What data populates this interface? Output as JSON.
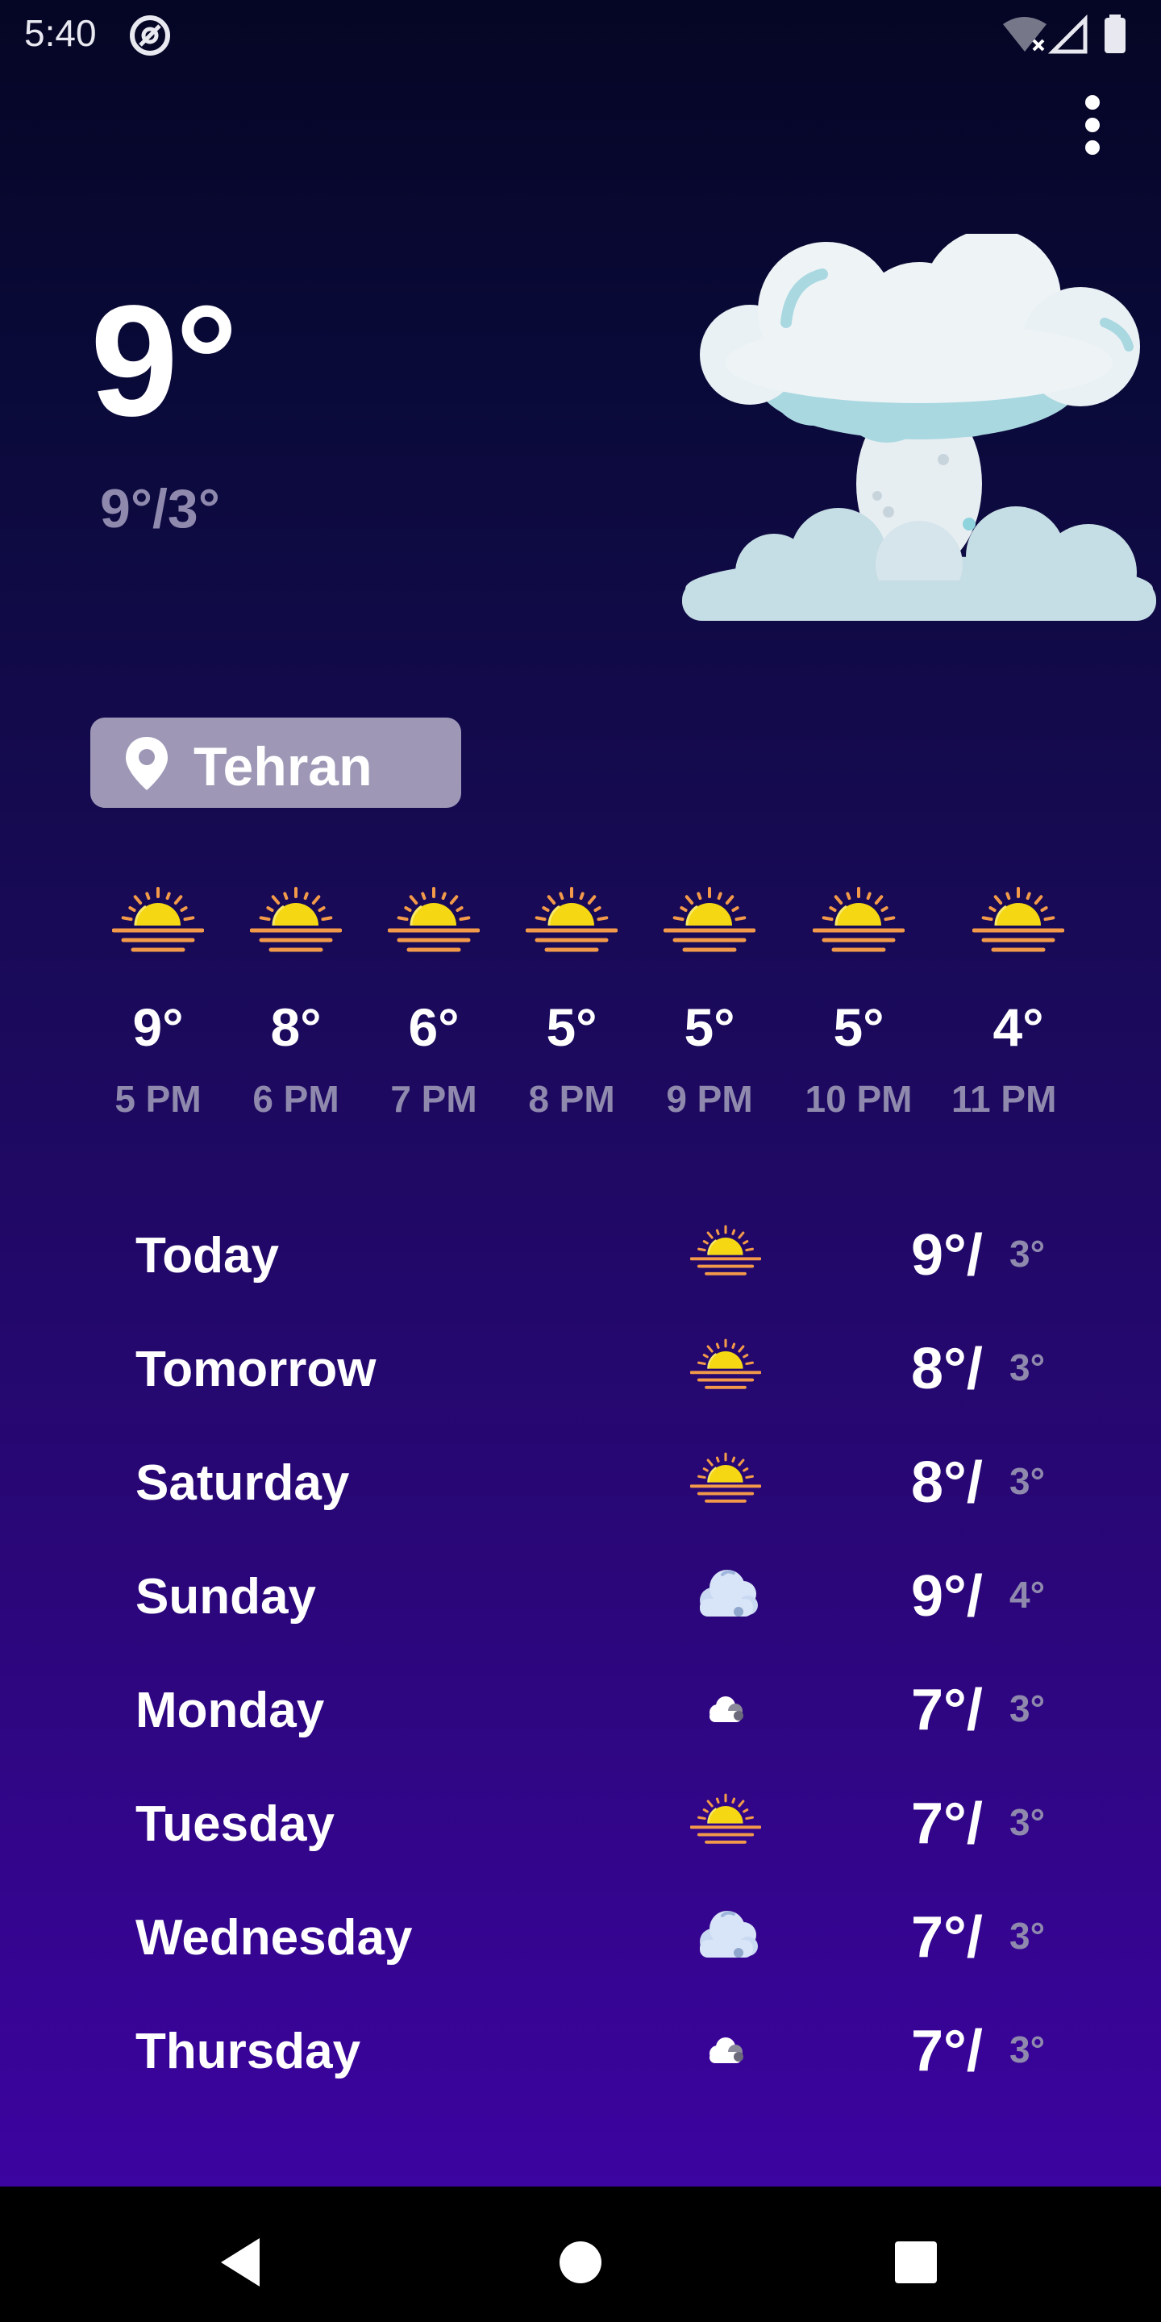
{
  "status_bar": {
    "time": "5:40"
  },
  "current": {
    "temperature": "9°",
    "high_low": "9°/3°",
    "condition_icon": "cloud-icon"
  },
  "location": {
    "name": "Tehran",
    "icon": "location-pin-icon"
  },
  "hourly": [
    {
      "temp": "9°",
      "time": "5 PM",
      "icon": "sunset-icon"
    },
    {
      "temp": "8°",
      "time": "6 PM",
      "icon": "sunset-icon"
    },
    {
      "temp": "6°",
      "time": "7 PM",
      "icon": "sunset-icon"
    },
    {
      "temp": "5°",
      "time": "8 PM",
      "icon": "sunset-icon"
    },
    {
      "temp": "5°",
      "time": "9 PM",
      "icon": "sunset-icon"
    },
    {
      "temp": "5°",
      "time": "10 PM",
      "icon": "sunset-icon"
    },
    {
      "temp": "4°",
      "time": "11 PM",
      "icon": "sunset-icon"
    }
  ],
  "daily": [
    {
      "day": "Today",
      "high": "9°/",
      "low": "3°",
      "icon": "sunset-icon"
    },
    {
      "day": "Tomorrow",
      "high": "8°/",
      "low": "3°",
      "icon": "sunset-icon"
    },
    {
      "day": "Saturday",
      "high": "8°/",
      "low": "3°",
      "icon": "sunset-icon"
    },
    {
      "day": "Sunday",
      "high": "9°/",
      "low": "4°",
      "icon": "cloud-icon"
    },
    {
      "day": "Monday",
      "high": "7°/",
      "low": "3°",
      "icon": "small-cloud-icon"
    },
    {
      "day": "Tuesday",
      "high": "7°/",
      "low": "3°",
      "icon": "sunset-icon"
    },
    {
      "day": "Wednesday",
      "high": "7°/",
      "low": "3°",
      "icon": "cloud-icon"
    },
    {
      "day": "Thursday",
      "high": "7°/",
      "low": "3°",
      "icon": "small-cloud-icon"
    }
  ],
  "colors": {
    "background_top": "#050525",
    "background_bottom": "#3c04a0",
    "secondary_text": "#8f89ad",
    "chip": "#9e98b6",
    "sun": "#f5d714",
    "sun_rays": "#f29a4a"
  }
}
